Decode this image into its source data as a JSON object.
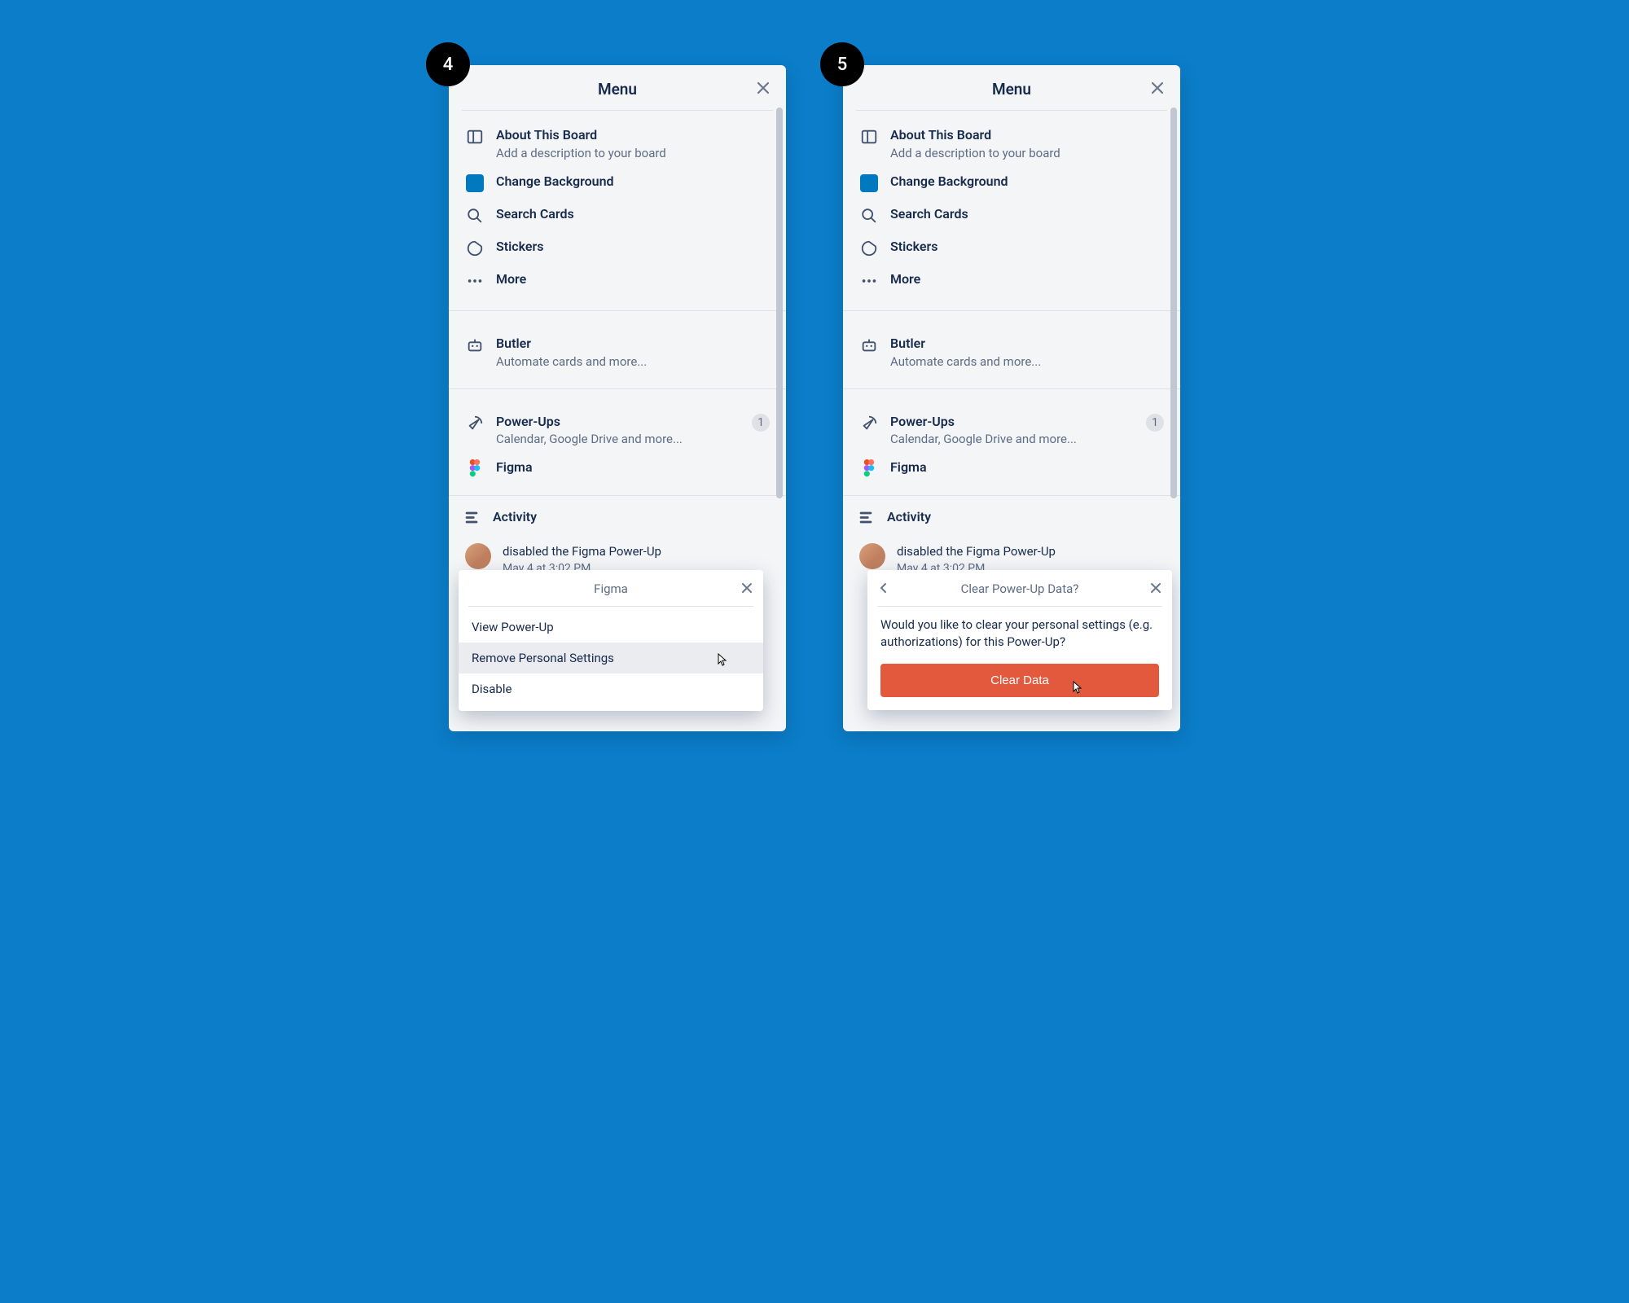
{
  "steps": [
    "4",
    "5"
  ],
  "menu": {
    "title": "Menu",
    "about": {
      "title": "About This Board",
      "sub": "Add a description to your board"
    },
    "changeBg": "Change Background",
    "search": "Search Cards",
    "stickers": "Stickers",
    "more": "More",
    "butler": {
      "title": "Butler",
      "sub": "Automate cards and more..."
    },
    "powerups": {
      "title": "Power-Ups",
      "sub": "Calendar, Google Drive and more...",
      "count": "1"
    },
    "figma": "Figma",
    "activityTitle": "Activity",
    "activityText": " disabled the Figma Power-Up",
    "activityTime": "May 4 at 3:02 PM"
  },
  "popover1": {
    "title": "Figma",
    "items": [
      "View Power-Up",
      "Remove Personal Settings",
      "Disable"
    ]
  },
  "popover2": {
    "title": "Clear Power-Up Data?",
    "body": "Would you like to clear your personal settings (e.g. authorizations) for this Power-Up?",
    "button": "Clear Data"
  }
}
